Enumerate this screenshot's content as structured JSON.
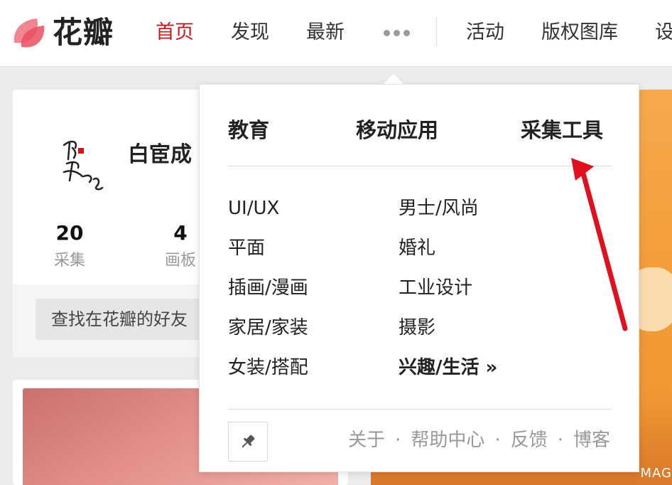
{
  "header": {
    "logo_text": "花瓣",
    "nav": {
      "home": "首页",
      "discover": "发现",
      "latest": "最新",
      "activity": "活动",
      "copyright_gallery": "版权图库",
      "settings_partial": "设"
    },
    "more_icon": "ellipsis-icon"
  },
  "profile": {
    "name": "白宦成",
    "stats": [
      {
        "value": "20",
        "label": "采集"
      },
      {
        "value": "4",
        "label": "画板"
      }
    ],
    "find_friends": "查找在花瓣的好友"
  },
  "dropdown": {
    "top_links": [
      "教育",
      "移动应用",
      "采集工具"
    ],
    "categories_left": [
      "UI/UX",
      "平面",
      "插画/漫画",
      "家居/家装",
      "女装/搭配"
    ],
    "categories_right": [
      "男士/风尚",
      "婚礼",
      "工业设计",
      "摄影",
      "兴趣/生活 »"
    ],
    "footer_links": [
      "关于",
      "帮助中心",
      "反馈",
      "博客"
    ],
    "footer_separator": "·",
    "pin_icon": "pushpin-icon"
  },
  "background_pin": {
    "mag_label": "MAG"
  },
  "annotation": {
    "color": "#e0101e",
    "icon": "red-arrow-pointing-to-collect-tool"
  },
  "colors": {
    "brand_red": "#c9171e",
    "logo_pink": "#f06a77",
    "orange_pin": "#f39c38"
  }
}
